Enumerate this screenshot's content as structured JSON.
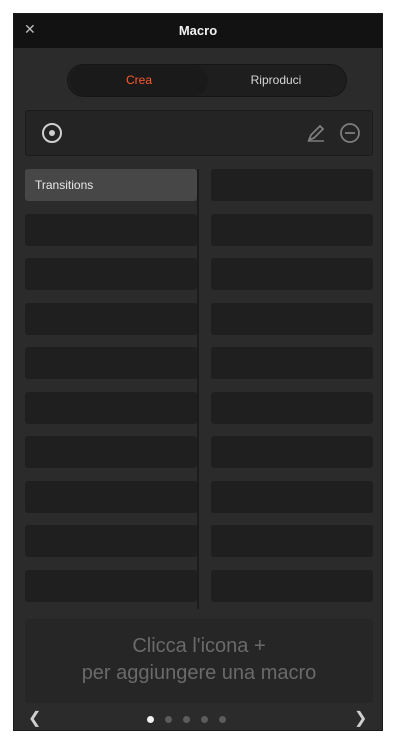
{
  "window": {
    "title": "Macro",
    "close_icon": "close-icon"
  },
  "tabs": {
    "create_label": "Crea",
    "run_label": "Riproduci",
    "accent": "#ff5a2e"
  },
  "toolbar": {
    "add_icon": "add-macro-icon",
    "edit_icon": "edit-icon",
    "delete_icon": "delete-icon"
  },
  "slots": [
    "Transitions",
    "",
    "",
    "",
    "",
    "",
    "",
    "",
    "",
    "",
    "",
    "",
    "",
    "",
    "",
    "",
    "",
    "",
    "",
    ""
  ],
  "hint": {
    "line1": "Clicca l'icona +",
    "line2": "per aggiungere una macro"
  },
  "pager": {
    "pages": 5,
    "current": 1,
    "prev_icon": "chevron-left-icon",
    "next_icon": "chevron-right-icon"
  }
}
